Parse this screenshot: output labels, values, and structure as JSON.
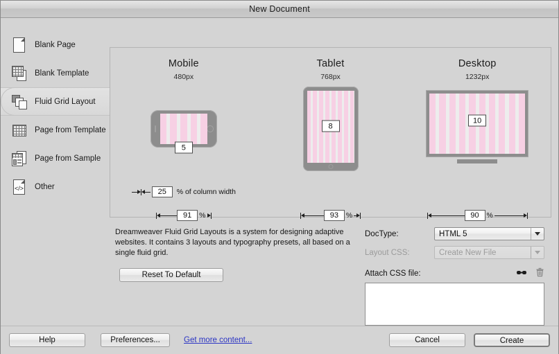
{
  "window": {
    "title": "New Document"
  },
  "sidebar": {
    "items": [
      {
        "label": "Blank Page",
        "icon": "blank-page-icon",
        "selected": false
      },
      {
        "label": "Blank Template",
        "icon": "blank-template-icon",
        "selected": false
      },
      {
        "label": "Fluid Grid Layout",
        "icon": "fluid-grid-layout-icon",
        "selected": true
      },
      {
        "label": "Page from Template",
        "icon": "page-from-template-icon",
        "selected": false
      },
      {
        "label": "Page from Sample",
        "icon": "page-from-sample-icon",
        "selected": false
      },
      {
        "label": "Other",
        "icon": "code-other-icon",
        "selected": false
      }
    ]
  },
  "devices": [
    {
      "name": "Mobile",
      "width_label": "480px",
      "columns": "5",
      "column_count": 5,
      "gutter_value": "25",
      "gutter_unit_label": "% of column width",
      "width_value": "91",
      "width_unit": "%"
    },
    {
      "name": "Tablet",
      "width_label": "768px",
      "columns": "8",
      "column_count": 8,
      "width_value": "93",
      "width_unit": "%"
    },
    {
      "name": "Desktop",
      "width_label": "1232px",
      "columns": "10",
      "column_count": 10,
      "width_value": "90",
      "width_unit": "%"
    }
  ],
  "description": {
    "text": "Dreamweaver Fluid Grid Layouts is a system for designing adaptive websites. It contains 3 layouts and typography presets, all based on a single fluid grid."
  },
  "buttons": {
    "reset": "Reset To Default",
    "help": "Help",
    "preferences": "Preferences...",
    "get_more_content": "Get more content...",
    "cancel": "Cancel",
    "create": "Create"
  },
  "options": {
    "doctype_label": "DocType:",
    "doctype_value": "HTML 5",
    "layout_css_label": "Layout CSS:",
    "layout_css_value": "Create New File",
    "attach_css_label": "Attach CSS file:",
    "attach_css_items": []
  },
  "colors": {
    "dialog_bg": "#d4d4d4",
    "stripe": "#f7d0e4",
    "screen": "#ededed",
    "device_frame": "#8d8d8d",
    "link": "#2b34c4"
  }
}
